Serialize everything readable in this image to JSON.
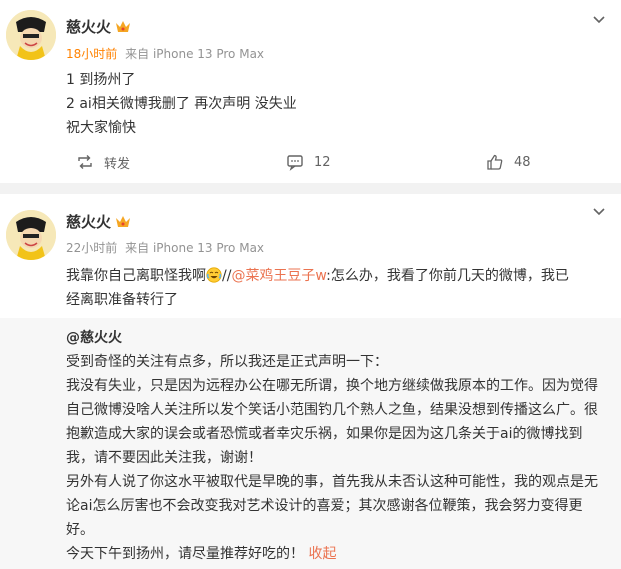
{
  "posts": [
    {
      "author": "慈火火",
      "time": "18小时前",
      "source_prefix": "来自",
      "source": "iPhone 13 Pro Max",
      "lines": [
        "1 到扬州了",
        "2 ai相关微博我删了 再次声明 没失业",
        "祝大家愉快"
      ],
      "actions": {
        "repost": "转发",
        "comments": "12",
        "likes": "48"
      }
    },
    {
      "author": "慈火火",
      "time": "22小时前",
      "source_prefix": "来自",
      "source": "iPhone 13 Pro Max",
      "text_before": "我靠你自己离职怪我啊",
      "text_slashes": "//",
      "mention": "@菜鸡王豆子w",
      "text_after_line1": ":怎么办，我看了你前几天的微博，我已",
      "text_line2": "经离职准备转行了",
      "quoted": {
        "author": "@慈火火",
        "paragraphs": [
          "受到奇怪的关注有点多，所以我还是正式声明一下：",
          "我没有失业，只是因为远程办公在哪无所谓，换个地方继续做我原本的工作。因为觉得自己微博没啥人关注所以发个笑话小范围钓几个熟人之鱼，结果没想到传播这么广。很抱歉造成大家的误会或者恐慌或者幸灾乐祸，如果你是因为这几条关于ai的微博找到我，请不要因此关注我，谢谢！",
          "另外有人说了你这水平被取代是早晚的事，首先我从未否认这种可能性，我的观点是无论ai怎么厉害也不会改变我对艺术设计的喜爱；其次感谢各位鞭策，我会努力变得更好。",
          "今天下午到扬州，请尽量推荐好吃的！"
        ],
        "collapse": "收起"
      }
    }
  ],
  "icons": {
    "crown": "crown-icon",
    "chevron": "chevron-down-icon",
    "repost": "repost-icon",
    "comment": "comment-icon",
    "like": "like-icon",
    "emoji": "laughing-tears-emoji"
  },
  "colors": {
    "accent_orange": "#ff8200",
    "link": "#eb7350",
    "meta": "#939393"
  }
}
